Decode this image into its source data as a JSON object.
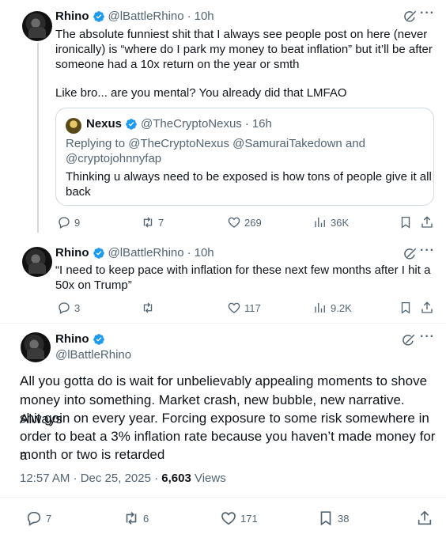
{
  "tweet1": {
    "name": "Rhino",
    "handle": "@lBattleRhino",
    "time": "10h",
    "line1": "The absolute funniest shit that I always see people post on here (never",
    "line2": "ironically) is “where do I park my money to beat inflation” but it’ll be after",
    "line3": "someone had a 10x return on the year or smth",
    "line4": "Like bro... are you mental? You already did that LMFAO",
    "quote": {
      "name": "Nexus",
      "handle": "@TheCryptoNexus",
      "time": "16h",
      "reply_line1": "Replying to @TheCryptoNexus @SamuraiTakedown and",
      "reply_line2": "@cryptojohnnyfap",
      "text_line1": "Thinking u always need to be exposed is how tons of people give it all",
      "text_line2": "back"
    },
    "replies": "9",
    "reposts": "7",
    "likes": "269",
    "views": "36K"
  },
  "tweet2": {
    "name": "Rhino",
    "handle": "@lBattleRhino",
    "time": "10h",
    "line1": "“I need to keep pace with inflation for these next few months after I hit a",
    "line2": "50x on Trump”",
    "replies": "3",
    "reposts": "",
    "likes": "117",
    "views": "9.2K"
  },
  "tweet3": {
    "name": "Rhino",
    "handle": "@lBattleRhino",
    "line1": "All you gotta do is wait for unbelievably appealing moments to shove",
    "line2": "money into something. Market crash, new bubble, new narrative. Always",
    "line3": "shit goin on every year. Forcing exposure to some risk somewhere in",
    "line4": "order to beat a 3% inflation rate because you haven’t made money for a",
    "line5": "month or two is retarded",
    "timestamp": "12:57 AM · Dec 25, 2025 · ",
    "views_count": "6,603",
    "views_label": " Views",
    "replies": "7",
    "reposts": "6",
    "likes": "171",
    "bookmarks": "38"
  },
  "colors": {
    "text": "#0f1419",
    "muted": "#536471",
    "verified": "#1d9bf0",
    "border": "#cfd9de"
  }
}
